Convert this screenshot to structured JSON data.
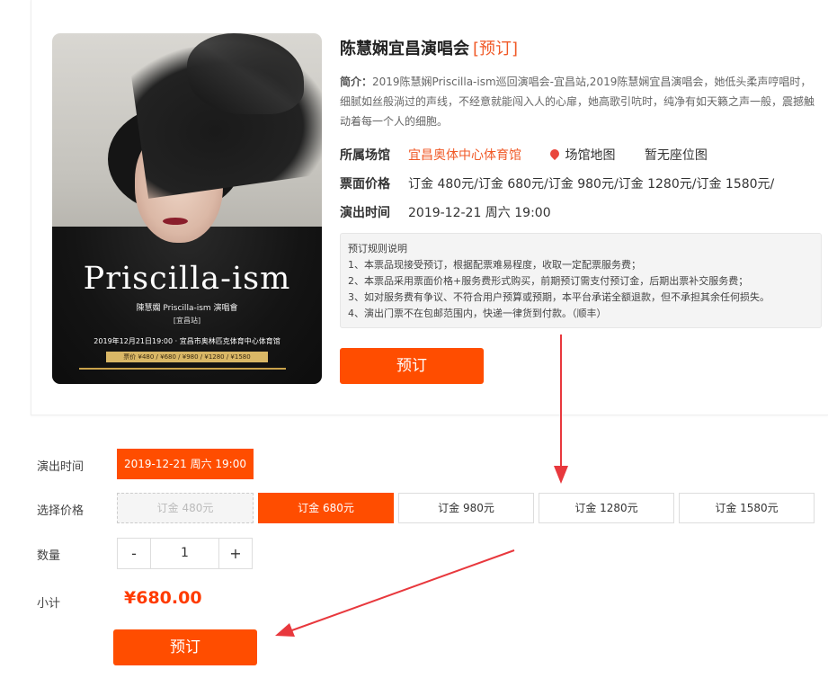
{
  "event": {
    "title": "陈慧娴宜昌演唱会",
    "status_tag": "[预订]",
    "intro_label": "简介：",
    "intro_text": "2019陈慧娴Priscilla-ism巡回演唱会-宜昌站,2019陈慧娴宜昌演唱会，她低头柔声哼唱时，细腻如丝般淌过的声线，不经意就能闯入人的心扉，她高歌引吭时，纯净有如天籁之声一般，震撼触动着每一个人的细胞。",
    "venue_label": "所属场馆",
    "venue_name": "宜昌奥体中心体育馆",
    "venue_map": "场馆地图",
    "seat_map": "暂无座位图",
    "price_label": "票面价格",
    "price_list": "订金 480元/订金 680元/订金 980元/订金 1280元/订金 1580元/",
    "time_label": "演出时间",
    "time_value": "2019-12-21 周六 19:00"
  },
  "poster": {
    "title": "Priscilla-ism",
    "subtitle": "陳慧嫻 Priscilla-ism 演唱會",
    "station": "[宜昌站]",
    "info": "2019年12月21日19:00 · 宜昌市奥林匹克体育中心体育馆",
    "prices": "票价 ¥480 / ¥680 / ¥980 / ¥1280 / ¥1580"
  },
  "rules": {
    "heading": "预订规则说明",
    "items": [
      "1、本票品现接受预订，根据配票难易程度，收取一定配票服务费；",
      "2、本票品采用票面价格+服务费形式购买，前期预订需支付预订金，后期出票补交服务费；",
      "3、如对服务费有争议、不符合用户预算或预期，本平台承诺全额退款，但不承担其余任何损失。",
      "4、演出门票不在包邮范围内，快递一律货到付款。（顺丰）"
    ]
  },
  "buttons": {
    "book_top": "预订",
    "book_bottom": "预订"
  },
  "form": {
    "time_label": "演出时间",
    "time_option": "2019-12-21 周六 19:00",
    "price_label": "选择价格",
    "price_options": [
      "订金 480元",
      "订金 680元",
      "订金 980元",
      "订金 1280元",
      "订金 1580元"
    ],
    "selected_price_index": 1,
    "disabled_price_index": 0,
    "qty_label": "数量",
    "qty_minus": "-",
    "qty_value": "1",
    "qty_plus": "+",
    "subtotal_label": "小计",
    "subtotal_value": "¥680.00"
  },
  "colors": {
    "accent": "#ff4d00",
    "link": "#f05a28",
    "annotation_arrow": "#e8383d"
  }
}
